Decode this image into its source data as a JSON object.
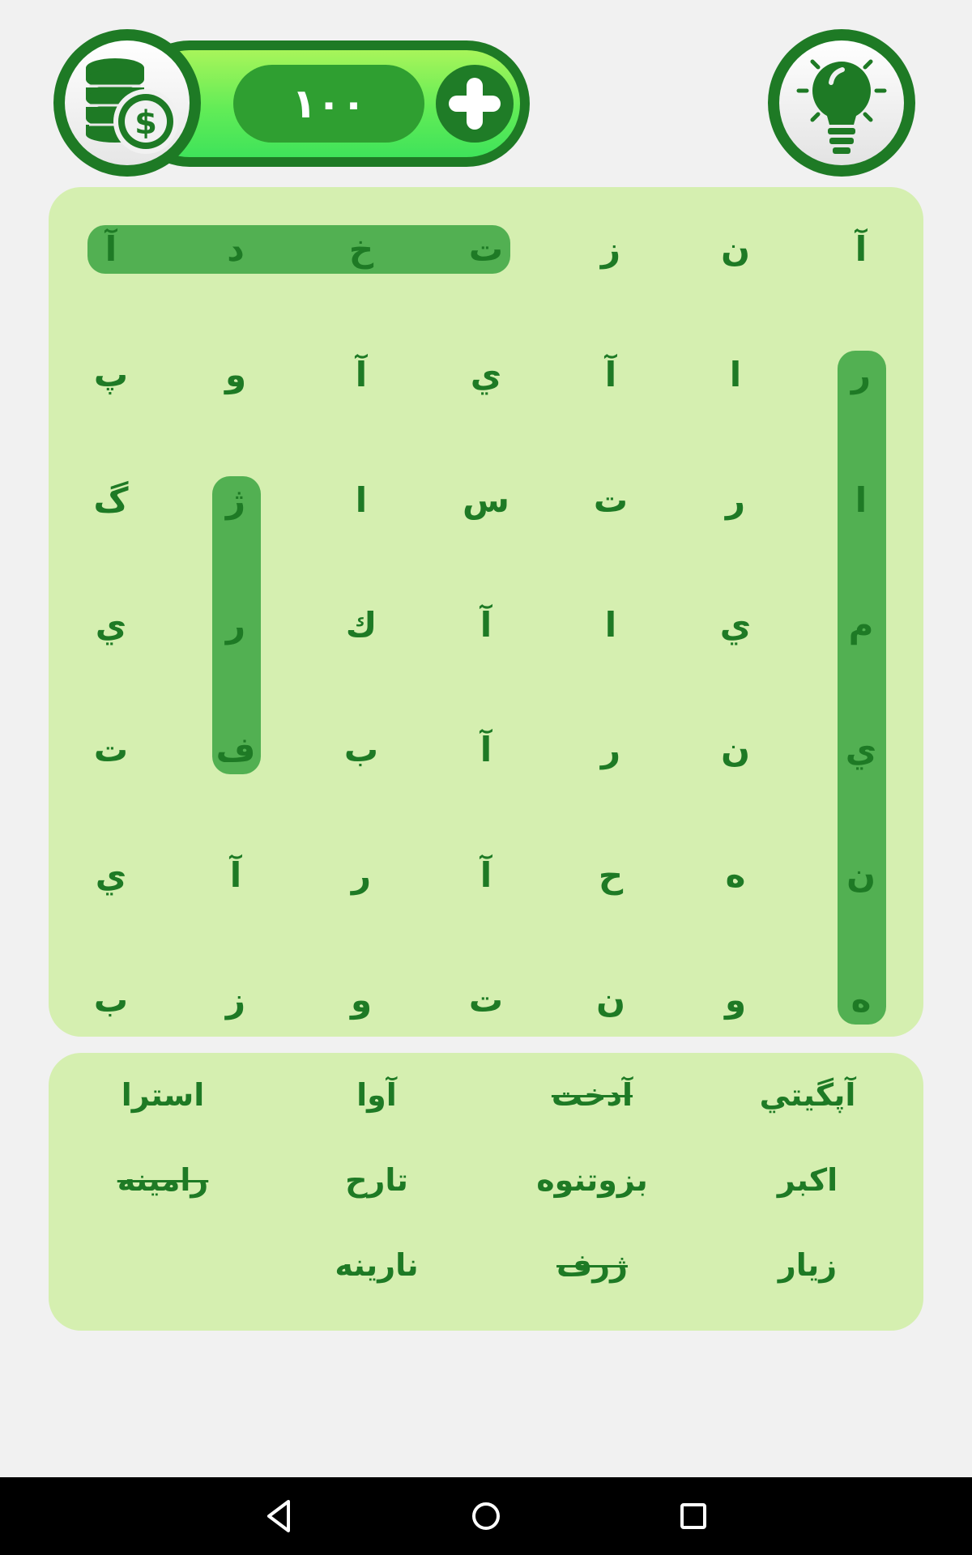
{
  "coins": {
    "count": "۱۰۰"
  },
  "icons": {
    "coins": "coins-stack-icon",
    "add": "plus-icon",
    "hint": "lightbulb-icon",
    "back": "back-triangle-icon",
    "home": "home-circle-icon",
    "recents": "recents-square-icon"
  },
  "colors": {
    "accent": "#1e7a25",
    "panel": "#d5efb0",
    "highlight": "#52b052",
    "coinbar_light": "#a8f55a"
  },
  "grid": {
    "rows": [
      [
        "آ",
        "ن",
        "ز",
        "ت",
        "خ",
        "د",
        "آ"
      ],
      [
        "ر",
        "ا",
        "آ",
        "ي",
        "آ",
        "و",
        "پ"
      ],
      [
        "ا",
        "ر",
        "ت",
        "س",
        "ا",
        "ژ",
        "گ"
      ],
      [
        "م",
        "ي",
        "ا",
        "آ",
        "ك",
        "ر",
        "ي"
      ],
      [
        "ي",
        "ن",
        "ر",
        "آ",
        "ب",
        "ف",
        "ت"
      ],
      [
        "ن",
        "ه",
        "ح",
        "آ",
        "ر",
        "آ",
        "ي"
      ],
      [
        "ه",
        "و",
        "ن",
        "ت",
        "و",
        "ز",
        "ب"
      ]
    ],
    "found_words": [
      {
        "word": "تخدآ",
        "start": [
          0,
          3
        ],
        "end": [
          0,
          6
        ]
      },
      {
        "word": "رامينه",
        "start": [
          1,
          0
        ],
        "end": [
          6,
          0
        ]
      },
      {
        "word": "ژرف",
        "start": [
          2,
          5
        ],
        "end": [
          4,
          5
        ]
      }
    ]
  },
  "words": [
    {
      "text": "آپگيتي",
      "found": false
    },
    {
      "text": "آدخت",
      "found": true
    },
    {
      "text": "آوا",
      "found": false
    },
    {
      "text": "استرا",
      "found": false
    },
    {
      "text": "اكبر",
      "found": false
    },
    {
      "text": "بزوتنوه",
      "found": false
    },
    {
      "text": "تارح",
      "found": false
    },
    {
      "text": "رامينه",
      "found": true
    },
    {
      "text": "زيار",
      "found": false
    },
    {
      "text": "ژرف",
      "found": true
    },
    {
      "text": "نارينه",
      "found": false
    }
  ]
}
